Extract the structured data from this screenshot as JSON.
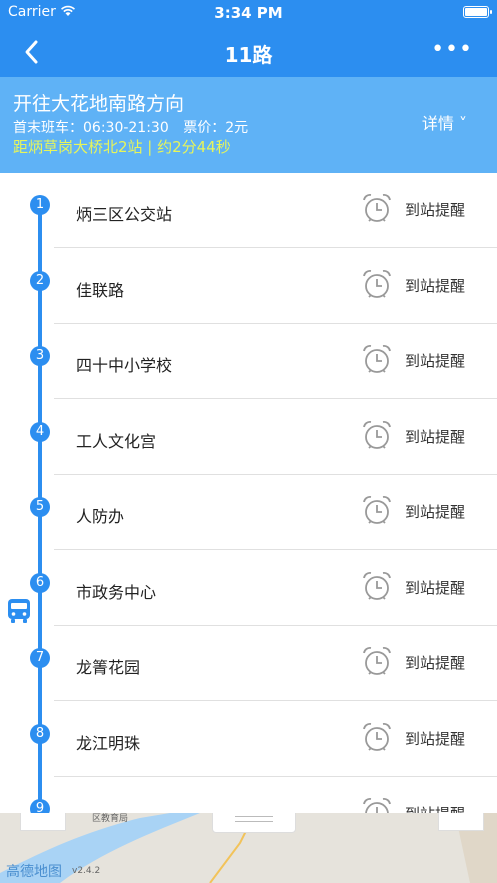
{
  "status_bar": {
    "carrier": "Carrier",
    "time": "3:34 PM"
  },
  "nav": {
    "title": "11路",
    "more": "•••"
  },
  "info": {
    "direction": "开往大花地南路方向",
    "first_last_label": "首末班车：06:30-21:30",
    "price_label": "票价：2元",
    "distance": "距炳草岗大桥北2站 | 约2分44秒",
    "detail": "详情 ˅"
  },
  "stations": [
    {
      "num": "1",
      "name": "炳三区公交站",
      "remind": "到站提醒"
    },
    {
      "num": "2",
      "name": "佳联路",
      "remind": "到站提醒"
    },
    {
      "num": "3",
      "name": "四十中小学校",
      "remind": "到站提醒"
    },
    {
      "num": "4",
      "name": "工人文化宫",
      "remind": "到站提醒"
    },
    {
      "num": "5",
      "name": "人防办",
      "remind": "到站提醒"
    },
    {
      "num": "6",
      "name": "市政务中心",
      "remind": "到站提醒"
    },
    {
      "num": "7",
      "name": "龙箐花园",
      "remind": "到站提醒"
    },
    {
      "num": "8",
      "name": "龙江明珠",
      "remind": "到站提醒"
    },
    {
      "num": "9",
      "name": "",
      "remind": "到站提醒"
    }
  ],
  "map": {
    "poi": "区教育局",
    "logo": "高德地图",
    "version": "v2.4.2"
  },
  "icons": {
    "back": "chevron-left-icon",
    "clock": "alarm-clock-icon",
    "bus": "bus-icon"
  },
  "colors": {
    "primary": "#2c8ef0",
    "header_light": "#5fb2f6",
    "distance": "#e7f55a"
  }
}
